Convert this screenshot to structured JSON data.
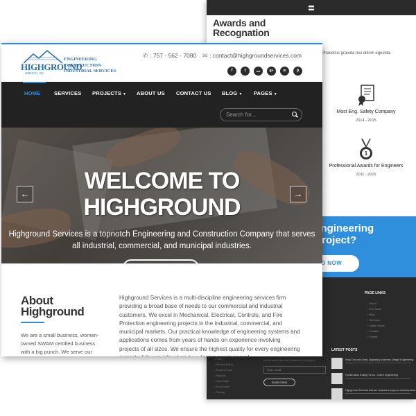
{
  "back": {
    "awards_heading": "Awards and Recognation",
    "awards_intro": "Phasellus gravida nisi elitom egestda.",
    "awards": [
      {
        "title": "Most Eng. Safety Company",
        "years": "2014 - 2015",
        "icon": "certificate-icon"
      },
      {
        "title": "Professional Awards for Engineers",
        "years": "2011 - 2015",
        "icon": "medal-icon"
      }
    ],
    "cta_line1": "st Engineering",
    "cta_line2": "ur Project?",
    "cta_button": "O NOW",
    "footer": {
      "page_links_head": "PAGE LINKS",
      "page_links": [
        "About",
        "Our Team",
        "Blog",
        "Services",
        "Latest News",
        "Contact",
        "Career"
      ],
      "quick_links": [
        "Policy",
        "Privacy Policy",
        "Terms of Use",
        "Support",
        "Help Desk",
        "Error Page",
        "Pricing"
      ],
      "newsletter_note": "Get the latest news and updates on our projects.",
      "email_placeholder": "Enter email",
      "subscribe": "SUBSCRIBE",
      "latest_posts_head": "LATEST POSTS",
      "posts": [
        "Shop Dial and Glass Upgrading Business Design Engineering",
        "Construction Eating Forum - Green Engineering",
        "Highground Services that are reasons to improve achievements"
      ]
    }
  },
  "front": {
    "logo": {
      "word": "HIGHGROUND",
      "sub": "SERVICES, INC.",
      "line1": "ENGINEERING",
      "line2": "CONSTRUCTION",
      "line3": "INDUSTRIAL SERVICES"
    },
    "phone": ": 757 - 562 - 7080",
    "email": ": contact@highgroundservices.com",
    "social": [
      "f",
      "t",
      "rss",
      "g+",
      "in",
      "p"
    ],
    "nav": [
      {
        "label": "HOME",
        "active": true
      },
      {
        "label": "SERVICES"
      },
      {
        "label": "PROJECTS",
        "dropdown": true
      },
      {
        "label": "ABOUT US"
      },
      {
        "label": "CONTACT US"
      },
      {
        "label": "BLOG",
        "dropdown": true
      },
      {
        "label": "PAGES",
        "dropdown": true
      }
    ],
    "search_placeholder": "Search for...",
    "hero_title_1": "WELCOME TO",
    "hero_title_2": "HIGHGROUND",
    "hero_subtitle": "Highground Services is a topnotch Engineering and Construction Company that serves all industrial, commercial, and municipal industries.",
    "prev_arrow": "←",
    "next_arrow": "→",
    "about_title_1": "About",
    "about_title_2": "Highground",
    "about_left": "We are a small business, women-owned SWAM certified business with a big punch. We serve our customers",
    "about_right": "Highground Services is a multi-discipline engineering services firm providing a broad base of needs to our commercial and industrial customers. We excel in Mechanical, Electrical, Controls, and Fire Protection engineering projects in the industrial, commercial, and municipal markets. Our practical knowledge of engineering systems and applications comes from years of hands-on experience involving projects of all sizes. We ensure the highest quality for every engineering project while providing turn-key design services and"
  },
  "colors": {
    "accent": "#2f8fdc",
    "nav_bg": "#222222",
    "footer_bg": "#2a2a2a",
    "logo_blue": "#2f6fb0"
  }
}
